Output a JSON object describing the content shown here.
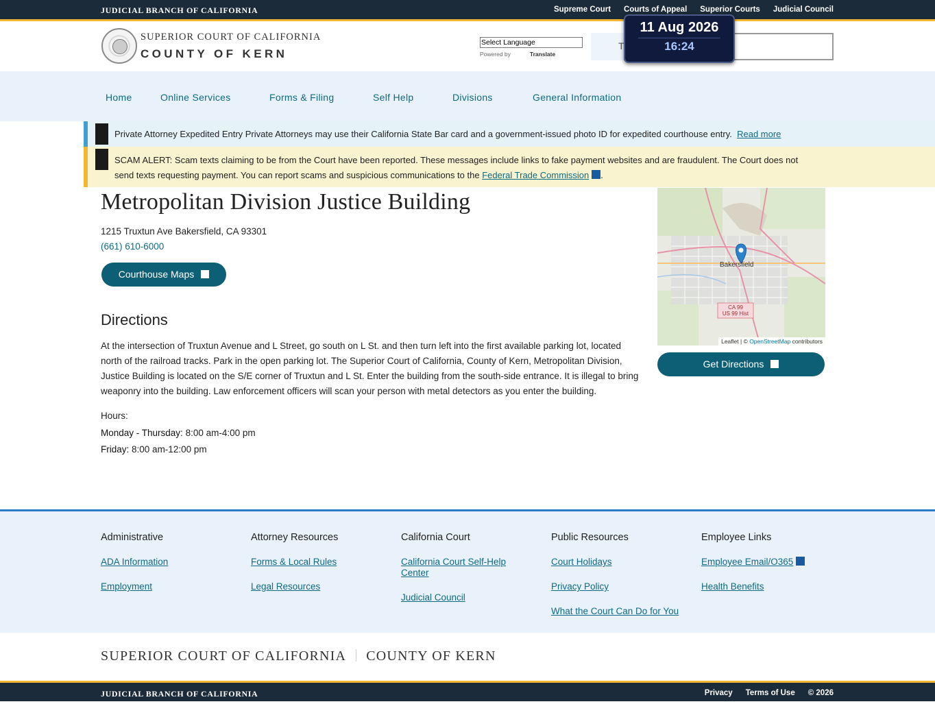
{
  "topbar": {
    "brand": "JUDICIAL BRANCH OF CALIFORNIA",
    "links": [
      "Supreme Court",
      "Courts of Appeal",
      "Superior Courts",
      "Judicial Council"
    ]
  },
  "header": {
    "logo_line1": "SUPERIOR COURT OF CALIFORNIA",
    "logo_line2": "COUNTY OF KERN",
    "language_select": "Select Language",
    "powered_by": "Powered by",
    "translate": "Translate",
    "search_placeholder": "T"
  },
  "clock": {
    "date": "11 Aug 2026",
    "time": "16:24"
  },
  "nav": [
    "Home",
    "Online Services",
    "Forms & Filing",
    "Self Help",
    "Divisions",
    "General Information"
  ],
  "alerts": {
    "attorney": {
      "text": "Private Attorney Expedited Entry Private Attorneys may use their California State Bar card and a government-issued photo ID for expedited courthouse entry.",
      "link": "Read more"
    },
    "scam": {
      "text": "SCAM ALERT: Scam texts claiming to be from the Court have been reported. These messages include links to fake payment websites and are fraudulent. The Court does not send texts requesting payment. You can report scams and suspicious communications to the",
      "link": "Federal Trade Commission",
      "end": "."
    }
  },
  "main": {
    "title": "Metropolitan Division Justice Building",
    "address": "1215 Truxtun Ave Bakersfield, CA 93301",
    "phone": "(661) 610-6000",
    "maps_button": "Courthouse Maps",
    "directions_heading": "Directions",
    "directions_text": "At the intersection of Truxtun Avenue and L Street, go south on L St. and then turn left into the first available parking lot, located north of the railroad tracks. Park in the open parking lot. The Superior Court of California, County of Kern, Metropolitan Division, Justice Building is located on the S/E corner of Truxtun and L St. Enter the building from the south-side entrance. It is illegal to bring weaponry into the building. Law enforcement officers will scan your person with metal detectors as you enter the building.",
    "hours_label": "Hours:",
    "hours": [
      {
        "days": "Monday - Thursday:",
        "time": "8:00 am-4:00 pm"
      },
      {
        "days": "Friday:",
        "time": "8:00 am-12:00 pm"
      }
    ]
  },
  "map": {
    "city_label": "Bakersfield",
    "shield1": "CA 99",
    "shield2": "US 99 Hist",
    "attribution_prefix": "Leaflet | ©",
    "attribution_link": "OpenStreetMap",
    "attribution_suffix": "contributors",
    "directions_button": "Get Directions"
  },
  "footer": {
    "columns": [
      {
        "heading": "Administrative",
        "links": [
          "ADA Information",
          "Employment"
        ]
      },
      {
        "heading": "Attorney Resources",
        "links": [
          "Forms & Local Rules",
          "Legal Resources"
        ]
      },
      {
        "heading": "California Court",
        "links": [
          "California Court Self-Help Center",
          "Judicial Council"
        ]
      },
      {
        "heading": "Public Resources",
        "links": [
          "Court Holidays",
          "Privacy Policy",
          "What the Court Can Do for You"
        ]
      },
      {
        "heading": "Employee Links",
        "links": [
          "Employee Email/O365",
          "Health Benefits"
        ]
      }
    ],
    "brand_left": "SUPERIOR COURT OF CALIFORNIA",
    "brand_right": "COUNTY OF KERN"
  },
  "bottombar": {
    "brand": "JUDICIAL BRANCH OF CALIFORNIA",
    "links": [
      "Privacy",
      "Terms of Use",
      "© 2026"
    ]
  },
  "colors": {
    "teal": "#0d5f75",
    "navy": "#1c2b39",
    "gold": "#f2b632",
    "footer_rule": "#2b7cc4"
  }
}
